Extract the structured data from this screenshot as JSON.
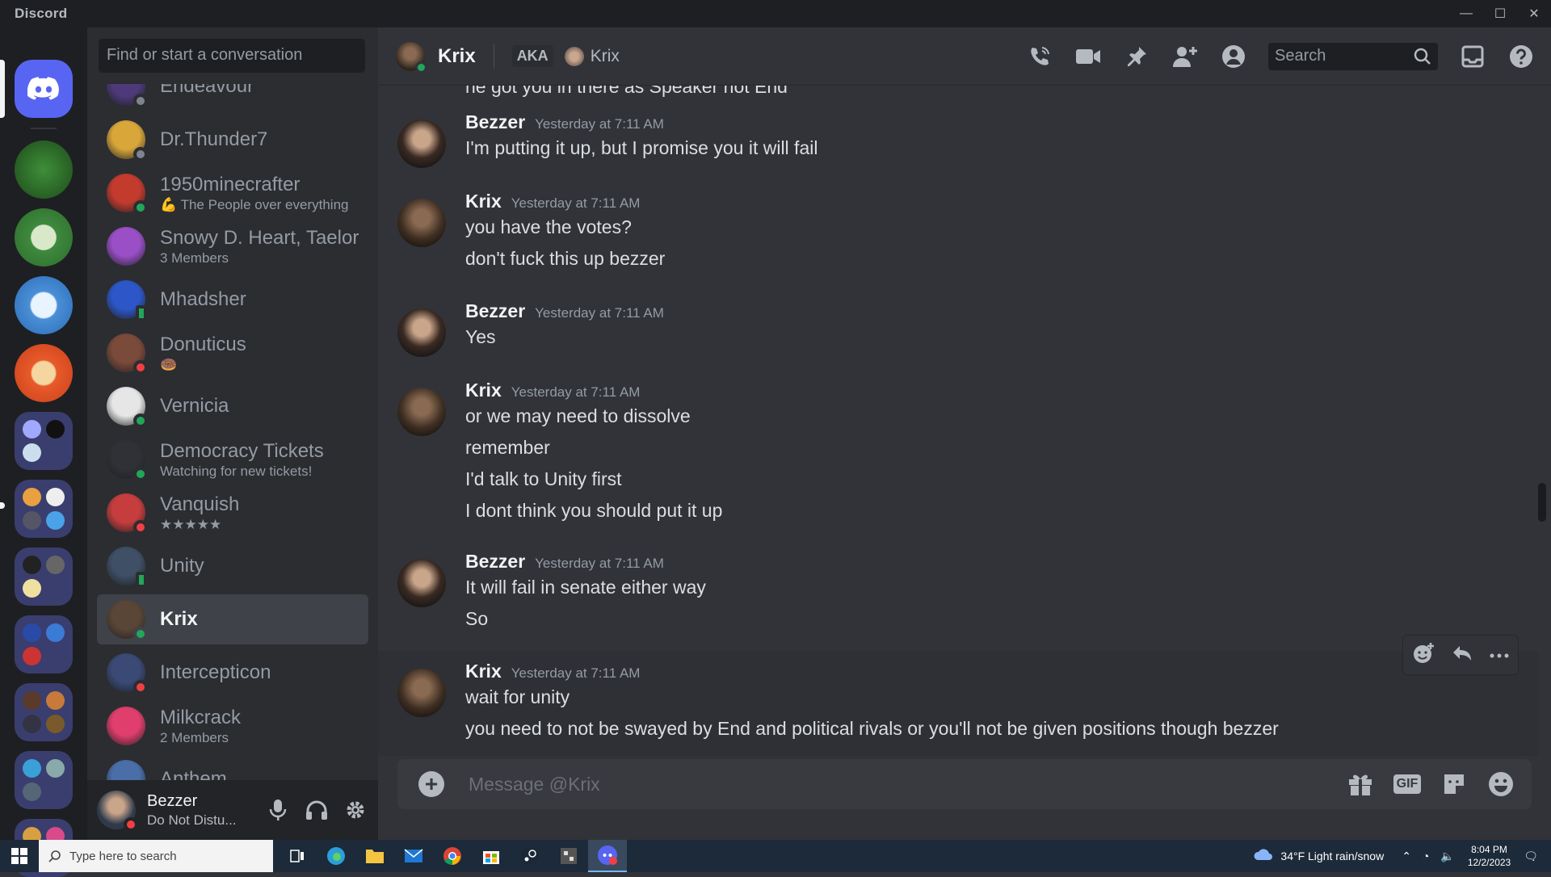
{
  "app": {
    "title": "Discord"
  },
  "window_controls": {
    "minimize": "—",
    "maximize": "☐",
    "close": "✕"
  },
  "dm_panel": {
    "search_placeholder": "Find or start a conversation",
    "items": [
      {
        "name": "Endeavour",
        "sub": "",
        "status": "idle",
        "color": "#4e3a7a"
      },
      {
        "name": "Dr.Thunder7",
        "sub": "",
        "status": "idle",
        "color": "#d9a63a"
      },
      {
        "name": "1950minecrafter",
        "sub": "💪 The People over everything",
        "status": "online",
        "color": "#c33b2d"
      },
      {
        "name": "Snowy D. Heart, Taelor",
        "sub": "3 Members",
        "status": "",
        "color": "#9b4fc7"
      },
      {
        "name": "Mhadsher",
        "sub": "",
        "status": "mobile",
        "color": "#2d57c8"
      },
      {
        "name": "Donuticus",
        "sub": "🍩",
        "status": "dnd",
        "color": "#7a4a3a"
      },
      {
        "name": "Vernicia",
        "sub": "",
        "status": "online",
        "color": "#e6e6e6"
      },
      {
        "name": "Democracy Tickets",
        "sub": "Watching for new tickets!",
        "status": "online",
        "color": "#2f3136"
      },
      {
        "name": "Vanquish",
        "sub": "★★★★★",
        "status": "dnd",
        "color": "#c63d3d"
      },
      {
        "name": "Unity",
        "sub": "",
        "status": "mobile",
        "color": "#3e4f66"
      },
      {
        "name": "Krix",
        "sub": "",
        "status": "online",
        "color": "#5a4636",
        "active": true
      },
      {
        "name": "Intercepticon",
        "sub": "",
        "status": "dnd",
        "color": "#3a4a75"
      },
      {
        "name": "Milkcrack",
        "sub": "2 Members",
        "status": "",
        "color": "#e03e6c"
      },
      {
        "name": "Anthem",
        "sub": "",
        "status": "",
        "color": "#4a6fa8"
      }
    ]
  },
  "user_panel": {
    "name": "Bezzer",
    "status": "Do Not Distu..."
  },
  "chat_header": {
    "title": "Krix",
    "aka_label": "AKA",
    "aka_name": "Krix",
    "search_placeholder": "Search"
  },
  "messages": [
    {
      "type": "cont",
      "text": "he got you in there as Speaker not End"
    },
    {
      "type": "group",
      "author": "Bezzer",
      "time": "Yesterday at 7:11 AM",
      "lines": [
        "I'm putting it up, but I promise you it will fail"
      ]
    },
    {
      "type": "group",
      "author": "Krix",
      "time": "Yesterday at 7:11 AM",
      "lines": [
        "you have the votes?",
        "don't fuck this up bezzer"
      ]
    },
    {
      "type": "group",
      "author": "Bezzer",
      "time": "Yesterday at 7:11 AM",
      "lines": [
        "Yes"
      ]
    },
    {
      "type": "group",
      "author": "Krix",
      "time": "Yesterday at 7:11 AM",
      "lines": [
        "or we may need to dissolve",
        "remember",
        "I'd talk to Unity first",
        "I dont think you should put it up"
      ]
    },
    {
      "type": "group",
      "author": "Bezzer",
      "time": "Yesterday at 7:11 AM",
      "lines": [
        "It will fail in senate either way",
        "So"
      ]
    },
    {
      "type": "group",
      "author": "Krix",
      "time": "Yesterday at 7:11 AM",
      "lines": [
        "wait for unity",
        "you need to not be swayed by End and political rivals or you'll not be given positions though bezzer"
      ]
    }
  ],
  "composer": {
    "placeholder": "Message @Krix",
    "gif_label": "GIF"
  },
  "taskbar": {
    "search_placeholder": "Type here to search",
    "weather": "34°F  Light rain/snow",
    "time": "8:04 PM",
    "date": "12/2/2023"
  },
  "colors": {
    "accent": "#5865f2",
    "online": "#23a55a",
    "dnd": "#f23f43"
  }
}
